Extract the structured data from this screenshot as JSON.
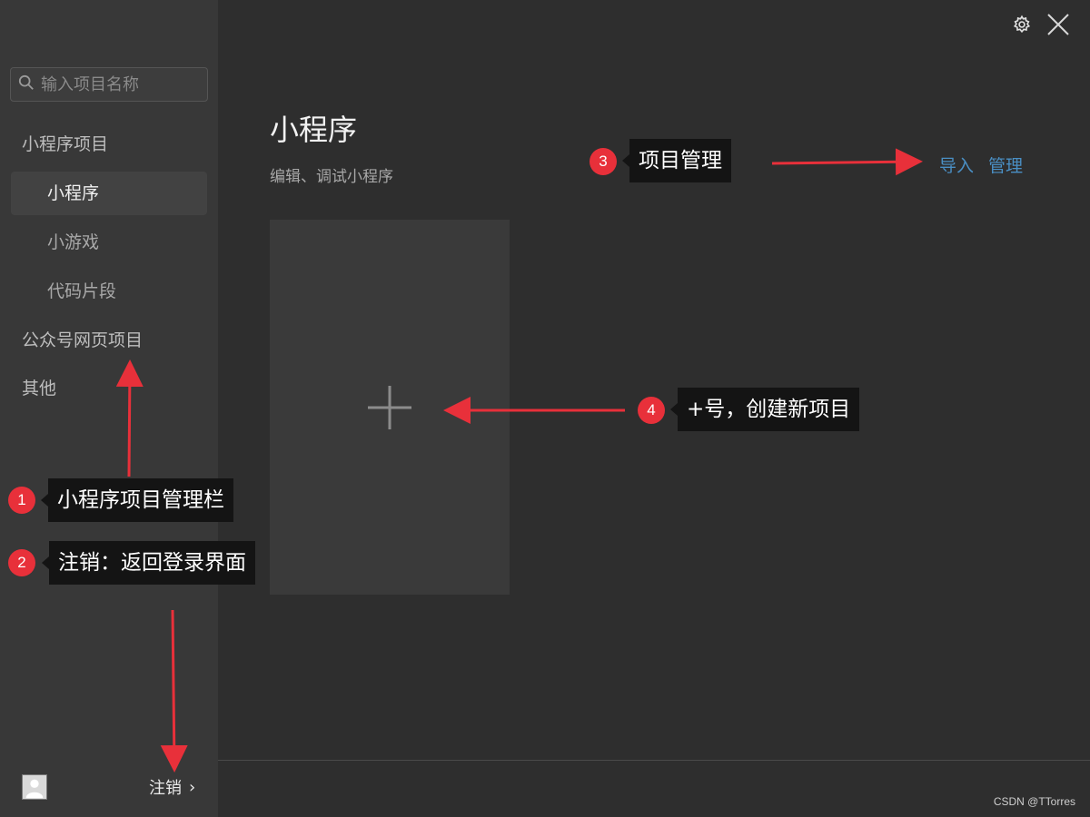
{
  "window": {
    "settings_icon": "gear-icon",
    "close_icon": "close-icon"
  },
  "sidebar": {
    "search": {
      "placeholder": "输入项目名称"
    },
    "groups": [
      {
        "label": "小程序项目"
      },
      {
        "label": "公众号网页项目"
      },
      {
        "label": "其他"
      }
    ],
    "sub_items": [
      {
        "label": "小程序",
        "active": true
      },
      {
        "label": "小游戏",
        "active": false
      },
      {
        "label": "代码片段",
        "active": false
      }
    ],
    "footer": {
      "logout_label": "注销",
      "chevron": "›"
    }
  },
  "main": {
    "title": "小程序",
    "subtitle": "编辑、调试小程序",
    "actions": {
      "import_label": "导入",
      "manage_label": "管理"
    },
    "add_card_icon": "plus-icon"
  },
  "annotations": [
    {
      "number": "1",
      "text": "小程序项目管理栏"
    },
    {
      "number": "2",
      "text": "注销：返回登录界面"
    },
    {
      "number": "3",
      "text": "项目管理"
    },
    {
      "number": "4",
      "text": "+号，创建新项目"
    }
  ],
  "watermark": "CSDN @TTorres",
  "colors": {
    "sidebar_bg": "#383838",
    "main_bg": "#2e2e2e",
    "link": "#4a8fc4",
    "annotation_red": "#e8303a",
    "callout_bg": "#141414"
  }
}
